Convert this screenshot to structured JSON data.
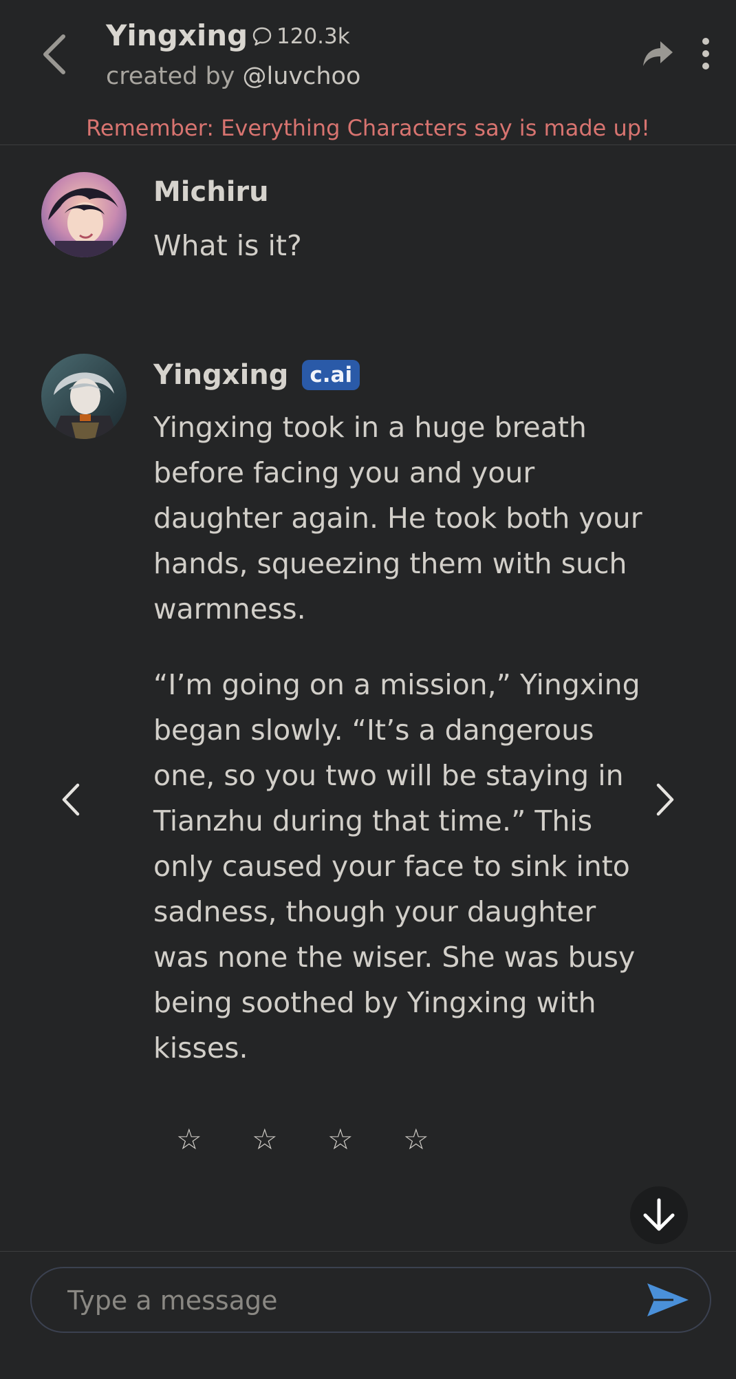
{
  "header": {
    "character_name": "Yingxing",
    "interaction_count": "120.3k",
    "creator_prefix": "created by",
    "creator_handle": "@luvchoo",
    "warning": "Remember: Everything Characters say is made up!"
  },
  "messages": [
    {
      "sender": "Michiru",
      "text": "What is it?"
    },
    {
      "sender": "Yingxing",
      "badge": "c.ai",
      "paragraphs": [
        "Yingxing took in a huge breath before facing you and your daughter again. He took both your hands, squeezing them with such warmness.",
        "“I’m going on a mission,” Yingxing began slowly. “It’s a dangerous one, so you two will be staying in Tianzhu during that time.” This only caused your face to sink into sadness, though your daughter was none the wiser. She was busy being soothed by Yingxing with kisses."
      ]
    }
  ],
  "rating": {
    "stars": [
      "☆",
      "☆",
      "☆",
      "☆"
    ]
  },
  "composer": {
    "placeholder": "Type a message"
  },
  "colors": {
    "background": "#242526",
    "warning": "#d87470",
    "badge": "#2a5aa8",
    "send": "#4a90d9"
  }
}
